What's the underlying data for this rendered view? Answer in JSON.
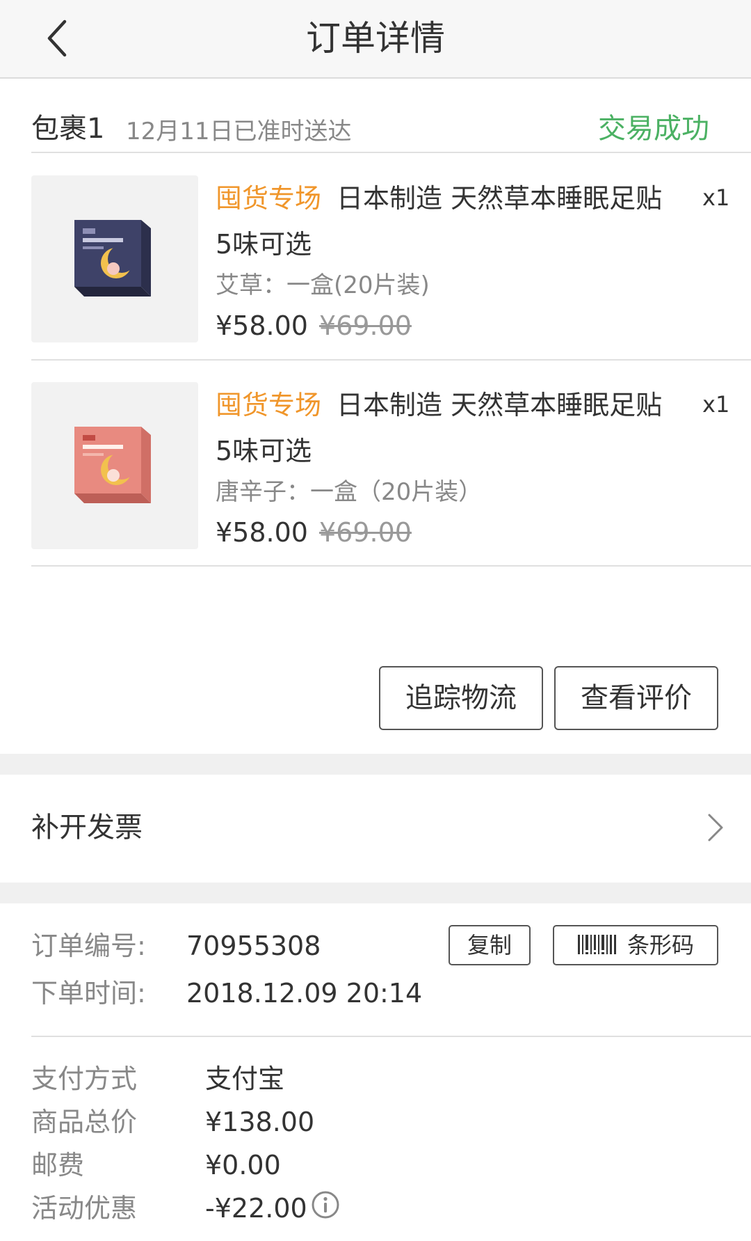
{
  "header": {
    "title": "订单详情",
    "back_icon": "chevron-left-icon"
  },
  "package": {
    "name": "包裹1",
    "delivery_note": "12月11日已准时送达",
    "status": "交易成功",
    "status_color": "#4bb163"
  },
  "items": [
    {
      "tag": "囤货专场",
      "title": "日本制造 天然草本睡眠足贴 5味可选",
      "quantity": "x1",
      "spec": "艾草：一盒(20片装)",
      "price": "¥58.00",
      "original_price": "¥69.00",
      "thumb_color": "#3e4268"
    },
    {
      "tag": "囤货专场",
      "title": "日本制造 天然草本睡眠足贴 5味可选",
      "quantity": "x1",
      "spec": "唐辛子：一盒（20片装）",
      "price": "¥58.00",
      "original_price": "¥69.00",
      "thumb_color": "#e88a80"
    }
  ],
  "actions": {
    "track": "追踪物流",
    "review": "查看评价"
  },
  "invoice": {
    "label": "补开发票"
  },
  "order": {
    "number_label": "订单编号:",
    "number": "70955308",
    "time_label": "下单时间:",
    "time": "2018.12.09 20:14",
    "copy_label": "复制",
    "barcode_label": "条形码"
  },
  "payment": {
    "method_label": "支付方式",
    "method": "支付宝",
    "total_label": "商品总价",
    "total": "¥138.00",
    "shipping_label": "邮费",
    "shipping": "¥0.00",
    "discount_label": "活动优惠",
    "discount": "-¥22.00"
  },
  "colors": {
    "accent_orange": "#f0962b",
    "success_green": "#4bb163"
  }
}
